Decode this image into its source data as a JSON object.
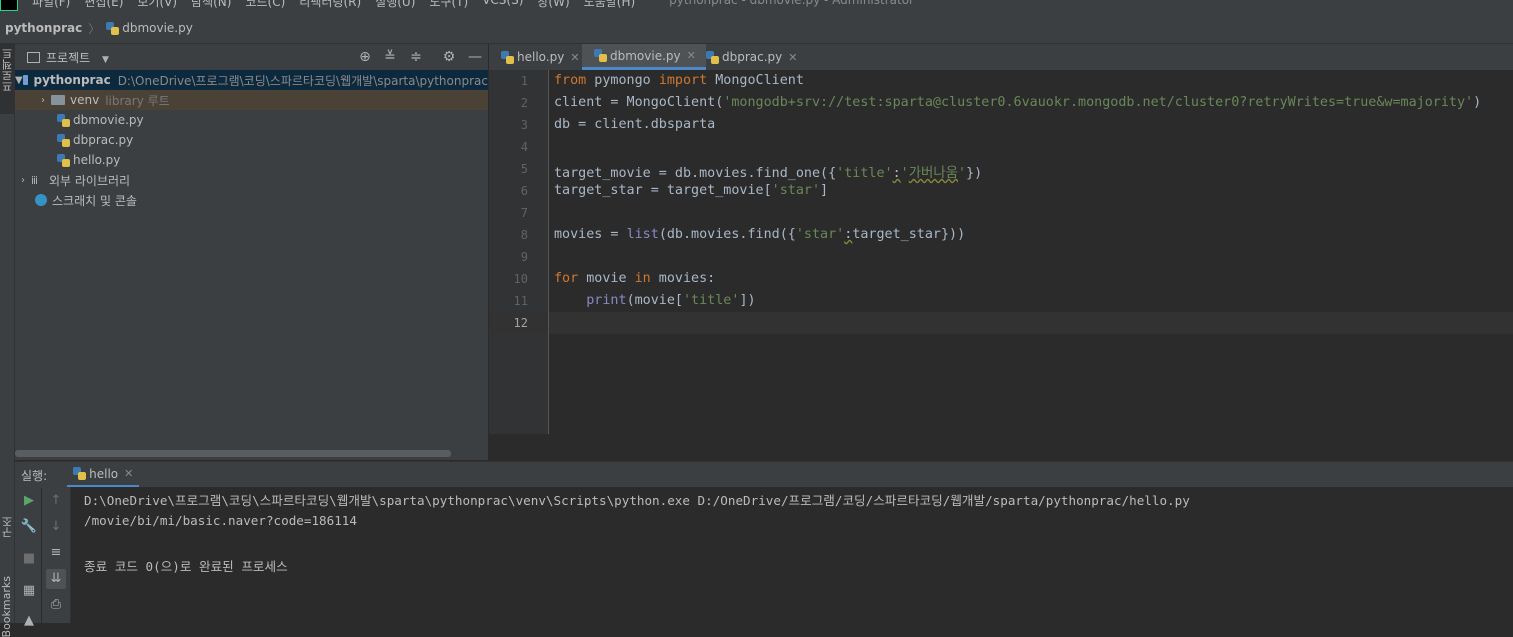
{
  "menubar": {
    "items": [
      "파일(F)",
      "편집(E)",
      "보기(V)",
      "탐색(N)",
      "코드(C)",
      "리팩터링(R)",
      "실행(U)",
      "도구(T)",
      "VCS(S)",
      "창(W)",
      "도움말(H)"
    ],
    "window_title": "pythonprac - dbmovie.py - Administrator"
  },
  "navbar": {
    "project": "pythonprac",
    "file": "dbmovie.py"
  },
  "left_stripe": {
    "project_label": "프로젝트",
    "structure_label": "구조",
    "bookmarks_label": "Bookmarks"
  },
  "project_panel": {
    "title": "프로젝트",
    "root_name": "pythonprac",
    "root_path": "D:\\OneDrive\\프로그램\\코딩\\스파르타코딩\\웹개발\\sparta\\pythonprac",
    "venv_name": "venv",
    "venv_hint": "library 루트",
    "files": [
      "dbmovie.py",
      "dbprac.py",
      "hello.py"
    ],
    "external_libs": "외부 라이브러리",
    "scratches": "스크래치 및 콘솔"
  },
  "editor": {
    "tabs": [
      {
        "label": "hello.py",
        "active": false
      },
      {
        "label": "dbmovie.py",
        "active": true
      },
      {
        "label": "dbprac.py",
        "active": false
      }
    ],
    "line_numbers": [
      "1",
      "2",
      "3",
      "4",
      "5",
      "6",
      "7",
      "8",
      "9",
      "10",
      "11",
      "12"
    ],
    "current_line": "12",
    "code": {
      "l1_from": "from",
      "l1_mod": " pymongo ",
      "l1_import": "import",
      "l1_rest": " MongoClient",
      "l2_pre": "client = MongoClient(",
      "l2_str": "'mongodb+srv://test:sparta@cluster0.6vauokr.mongodb.net/cluster0?retryWrites=true&w=majority'",
      "l2_post": ")",
      "l3": "db = client.dbsparta",
      "l5_pre": "target_movie = db.movies.find_one({",
      "l5_key": "'title'",
      "l5_colon": ":",
      "l5_val_q1": "'",
      "l5_val": "가버나움",
      "l5_val_q2": "'",
      "l5_post": "})",
      "l6_pre": "target_star = target_movie[",
      "l6_str": "'star'",
      "l6_post": "]",
      "l8_pre": "movies = ",
      "l8_list": "list",
      "l8_mid": "(db.movies.find({",
      "l8_key": "'star'",
      "l8_colon": ":",
      "l8_post": "target_star}))",
      "l10_for": "for",
      "l10_mid": " movie ",
      "l10_in": "in",
      "l10_post": " movies:",
      "l11_indent": "    ",
      "l11_print": "print",
      "l11_mid": "(movie[",
      "l11_str": "'title'",
      "l11_post": "])"
    }
  },
  "run_panel": {
    "label": "실행:",
    "tab": "hello",
    "output": [
      "D:\\OneDrive\\프로그램\\코딩\\스파르타코딩\\웹개발\\sparta\\pythonprac\\venv\\Scripts\\python.exe D:/OneDrive/프로그램/코딩/스파르타코딩/웹개발/sparta/pythonprac/hello.py",
      "/movie/bi/mi/basic.naver?code=186114",
      "",
      "종료 코드 0(으)로 완료된 프로세스"
    ]
  }
}
